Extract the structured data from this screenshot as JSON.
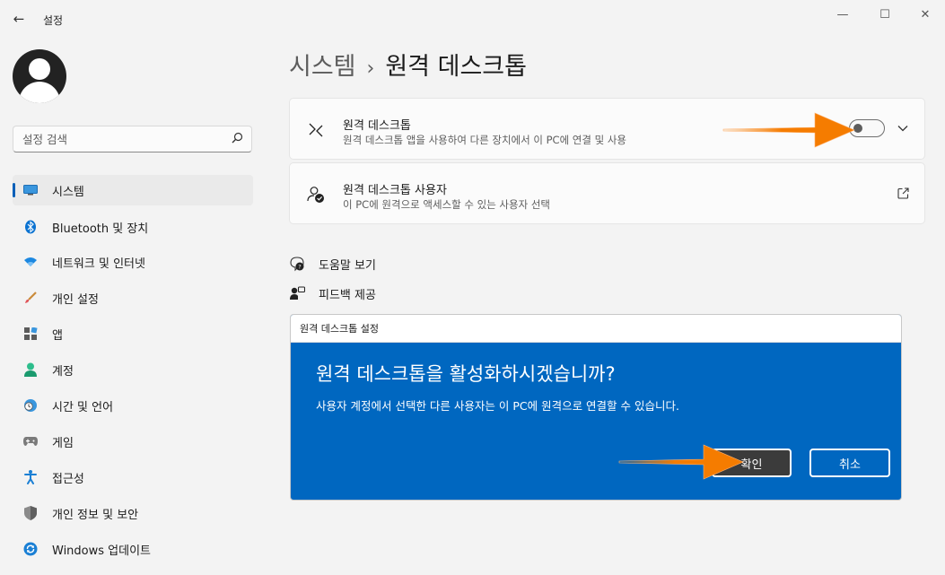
{
  "window": {
    "app_title": "설정",
    "back_glyph": "←",
    "minimize_glyph": "—",
    "maximize_glyph": "☐",
    "close_glyph": "✕"
  },
  "search": {
    "placeholder": "설정 검색",
    "icon": "search-icon"
  },
  "sidebar": {
    "items": [
      {
        "label": "시스템",
        "icon": "system-icon",
        "active": true
      },
      {
        "label": "Bluetooth 및 장치",
        "icon": "bluetooth-icon"
      },
      {
        "label": "네트워크 및 인터넷",
        "icon": "wifi-icon"
      },
      {
        "label": "개인 설정",
        "icon": "brush-icon"
      },
      {
        "label": "앱",
        "icon": "apps-icon"
      },
      {
        "label": "계정",
        "icon": "account-icon"
      },
      {
        "label": "시간 및 언어",
        "icon": "time-language-icon"
      },
      {
        "label": "게임",
        "icon": "gamepad-icon"
      },
      {
        "label": "접근성",
        "icon": "accessibility-icon"
      },
      {
        "label": "개인 정보 및 보안",
        "icon": "shield-icon"
      },
      {
        "label": "Windows 업데이트",
        "icon": "update-icon"
      }
    ]
  },
  "page": {
    "breadcrumb_parent": "시스템",
    "breadcrumb_sep": "›",
    "breadcrumb_current": "원격 데스크톱"
  },
  "cards": {
    "remote_desktop": {
      "title": "원격 데스크톱",
      "subtitle": "원격 데스크톱 앱을 사용하여 다른 장치에서 이 PC에 연결 및 사용",
      "toggle_on": false
    },
    "remote_users": {
      "title": "원격 데스크톱 사용자",
      "subtitle": "이 PC에 원격으로 액세스할 수 있는 사용자 선택"
    }
  },
  "links": {
    "help": "도움말 보기",
    "feedback": "피드백 제공"
  },
  "dialog": {
    "window_title": "원격 데스크톱 설정",
    "heading": "원격 데스크톱을 활성화하시겠습니까?",
    "body": "사용자 계정에서 선택한 다른 사용자는 이 PC에 원격으로 연결할 수 있습니다.",
    "confirm_label": "확인",
    "cancel_label": "취소"
  },
  "colors": {
    "accent": "#005fb8",
    "dialog_background": "#0067c0",
    "annotation_arrow": "#f57c00"
  }
}
